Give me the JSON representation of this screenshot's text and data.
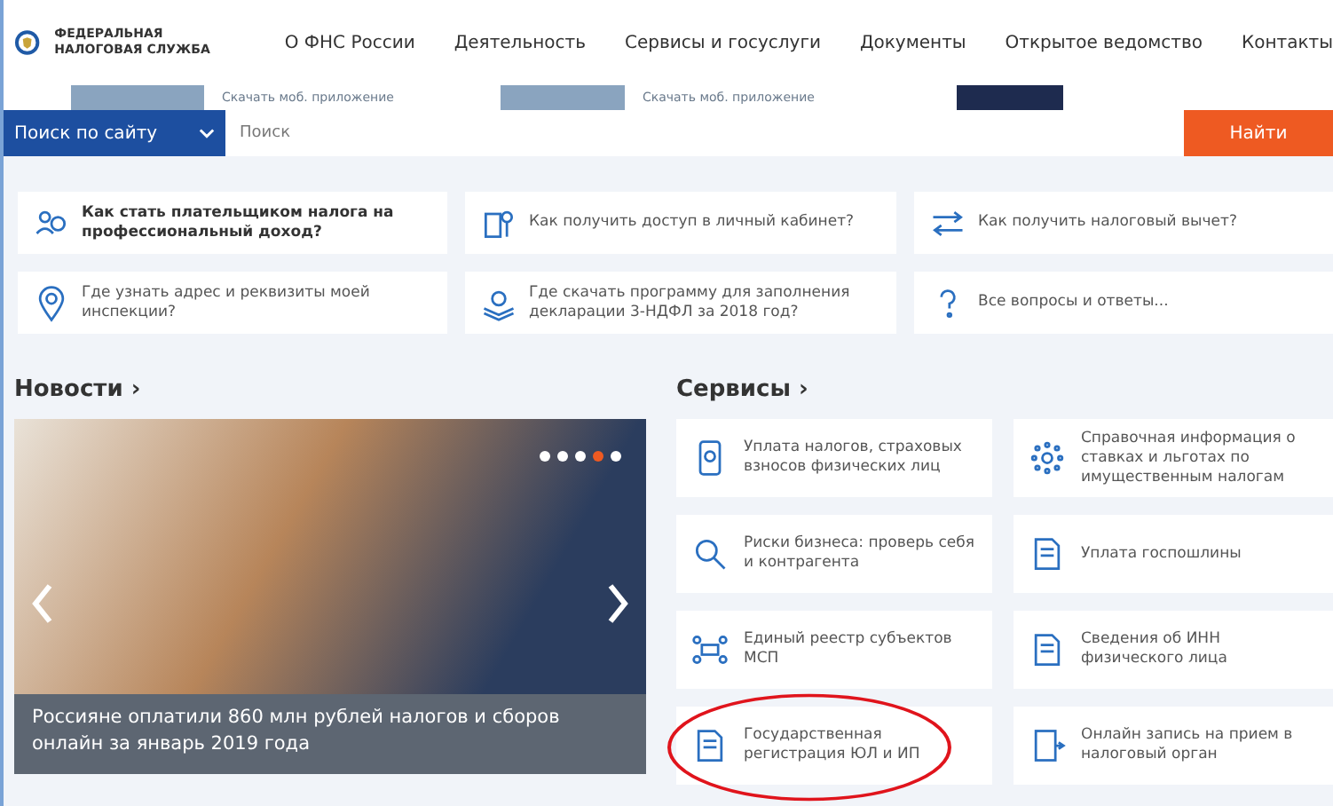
{
  "logo": {
    "lines": [
      "ФЕДЕРАЛЬНАЯ",
      "НАЛОГОВАЯ СЛУЖБА"
    ]
  },
  "nav": [
    {
      "label": "О ФНС России"
    },
    {
      "label": "Деятельность"
    },
    {
      "label": "Сервисы и госуслуги"
    },
    {
      "label": "Документы"
    },
    {
      "label": "Открытое ведомство"
    },
    {
      "label": "Контакты"
    }
  ],
  "banner": {
    "links": [
      "Скачать моб. приложение",
      "Скачать моб. приложение"
    ]
  },
  "search": {
    "scope": "Поиск по сайту",
    "placeholder": "Поиск",
    "button": "Найти"
  },
  "faq": [
    {
      "text": "Как стать плательщиком налога на профессиональный доход?",
      "bold": true
    },
    {
      "text": "Как получить доступ в личный кабинет?",
      "bold": false
    },
    {
      "text": "Как получить налоговый вычет?",
      "bold": false
    },
    {
      "text": "Где узнать адрес и реквизиты моей инспекции?",
      "bold": false
    },
    {
      "text": "Где скачать программу для заполнения декларации 3-НДФЛ за 2018 год?",
      "bold": false
    },
    {
      "text": "Все вопросы и ответы...",
      "bold": false
    }
  ],
  "news": {
    "heading": "Новости",
    "arrow": "›",
    "caption": "Россияне оплатили 860 млн рублей налогов и сборов онлайн за январь 2019 года",
    "dots": [
      {
        "selected": false
      },
      {
        "selected": false
      },
      {
        "selected": false
      },
      {
        "selected": true
      },
      {
        "selected": false
      }
    ]
  },
  "services": {
    "heading": "Сервисы",
    "arrow": "›",
    "items": [
      {
        "text": "Уплата налогов, страховых взносов физических лиц",
        "circled": false
      },
      {
        "text": "Справочная информация о ставках и льготах по имущественным налогам",
        "circled": false
      },
      {
        "text": "Риски бизнеса: проверь себя и контрагента",
        "circled": false
      },
      {
        "text": "Уплата госпошлины",
        "circled": false
      },
      {
        "text": "Единый реестр субъектов МСП",
        "circled": false
      },
      {
        "text": "Сведения об ИНН физического лица",
        "circled": false
      },
      {
        "text": "Государственная регистрация ЮЛ и ИП",
        "circled": true
      },
      {
        "text": "Онлайн запись на прием в налоговый орган",
        "circled": false
      }
    ]
  }
}
